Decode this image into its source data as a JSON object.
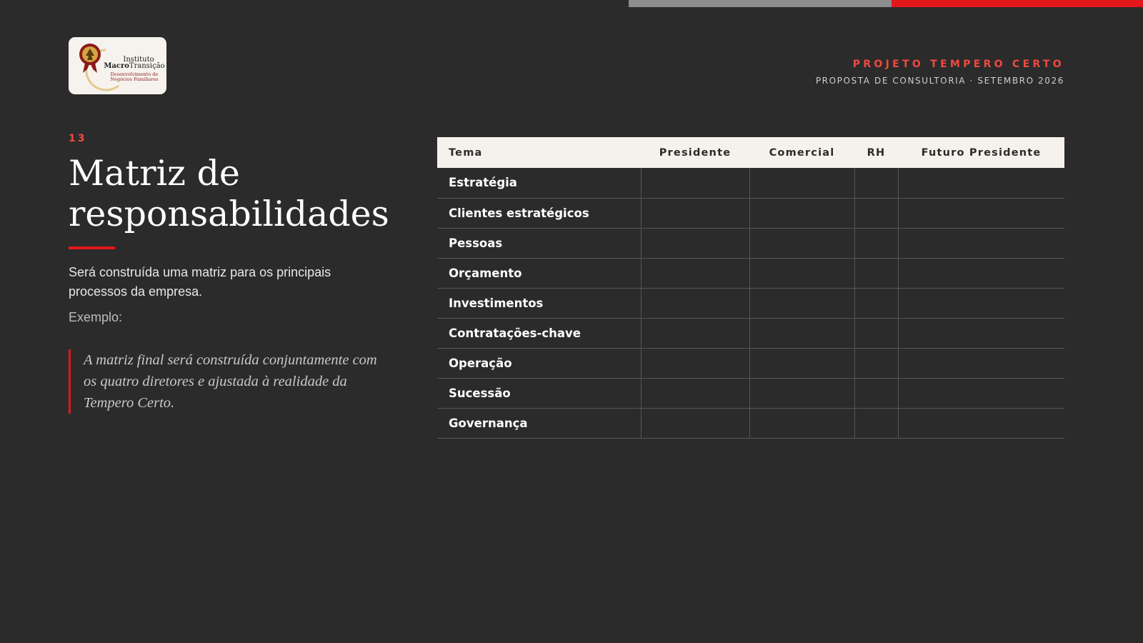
{
  "colors": {
    "background": "#2b2b2b",
    "accent_red": "#e3161b",
    "accent_red_text": "#f04a3f",
    "accent_gray": "#8e8e8e",
    "table_header_bg": "#f5f2ed"
  },
  "logo": {
    "line1": "Instituto",
    "line2a": "Macro",
    "line2b": "Transição",
    "line3": "Desenvolvimento de",
    "line4": "Negócios Familiares"
  },
  "header": {
    "project": "PROJETO TEMPERO CERTO",
    "subtitle": "PROPOSTA DE CONSULTORIA · SETEMBRO 2026"
  },
  "slide": {
    "number": "13",
    "title_line1": "Matriz de",
    "title_line2": "responsabilidades",
    "description": "Será construída uma matriz para os principais processos da empresa.",
    "example_label": "Exemplo:",
    "quote": "A matriz final será construída conjuntamente com os quatro diretores e ajustada à realidade da Tempero Certo."
  },
  "matrix": {
    "columns": [
      "Tema",
      "Presidente",
      "Comercial",
      "RH",
      "Futuro Presidente"
    ],
    "rows": [
      "Estratégia",
      "Clientes estratégicos",
      "Pessoas",
      "Orçamento",
      "Investimentos",
      "Contratações-chave",
      "Operação",
      "Sucessão",
      "Governança"
    ]
  }
}
